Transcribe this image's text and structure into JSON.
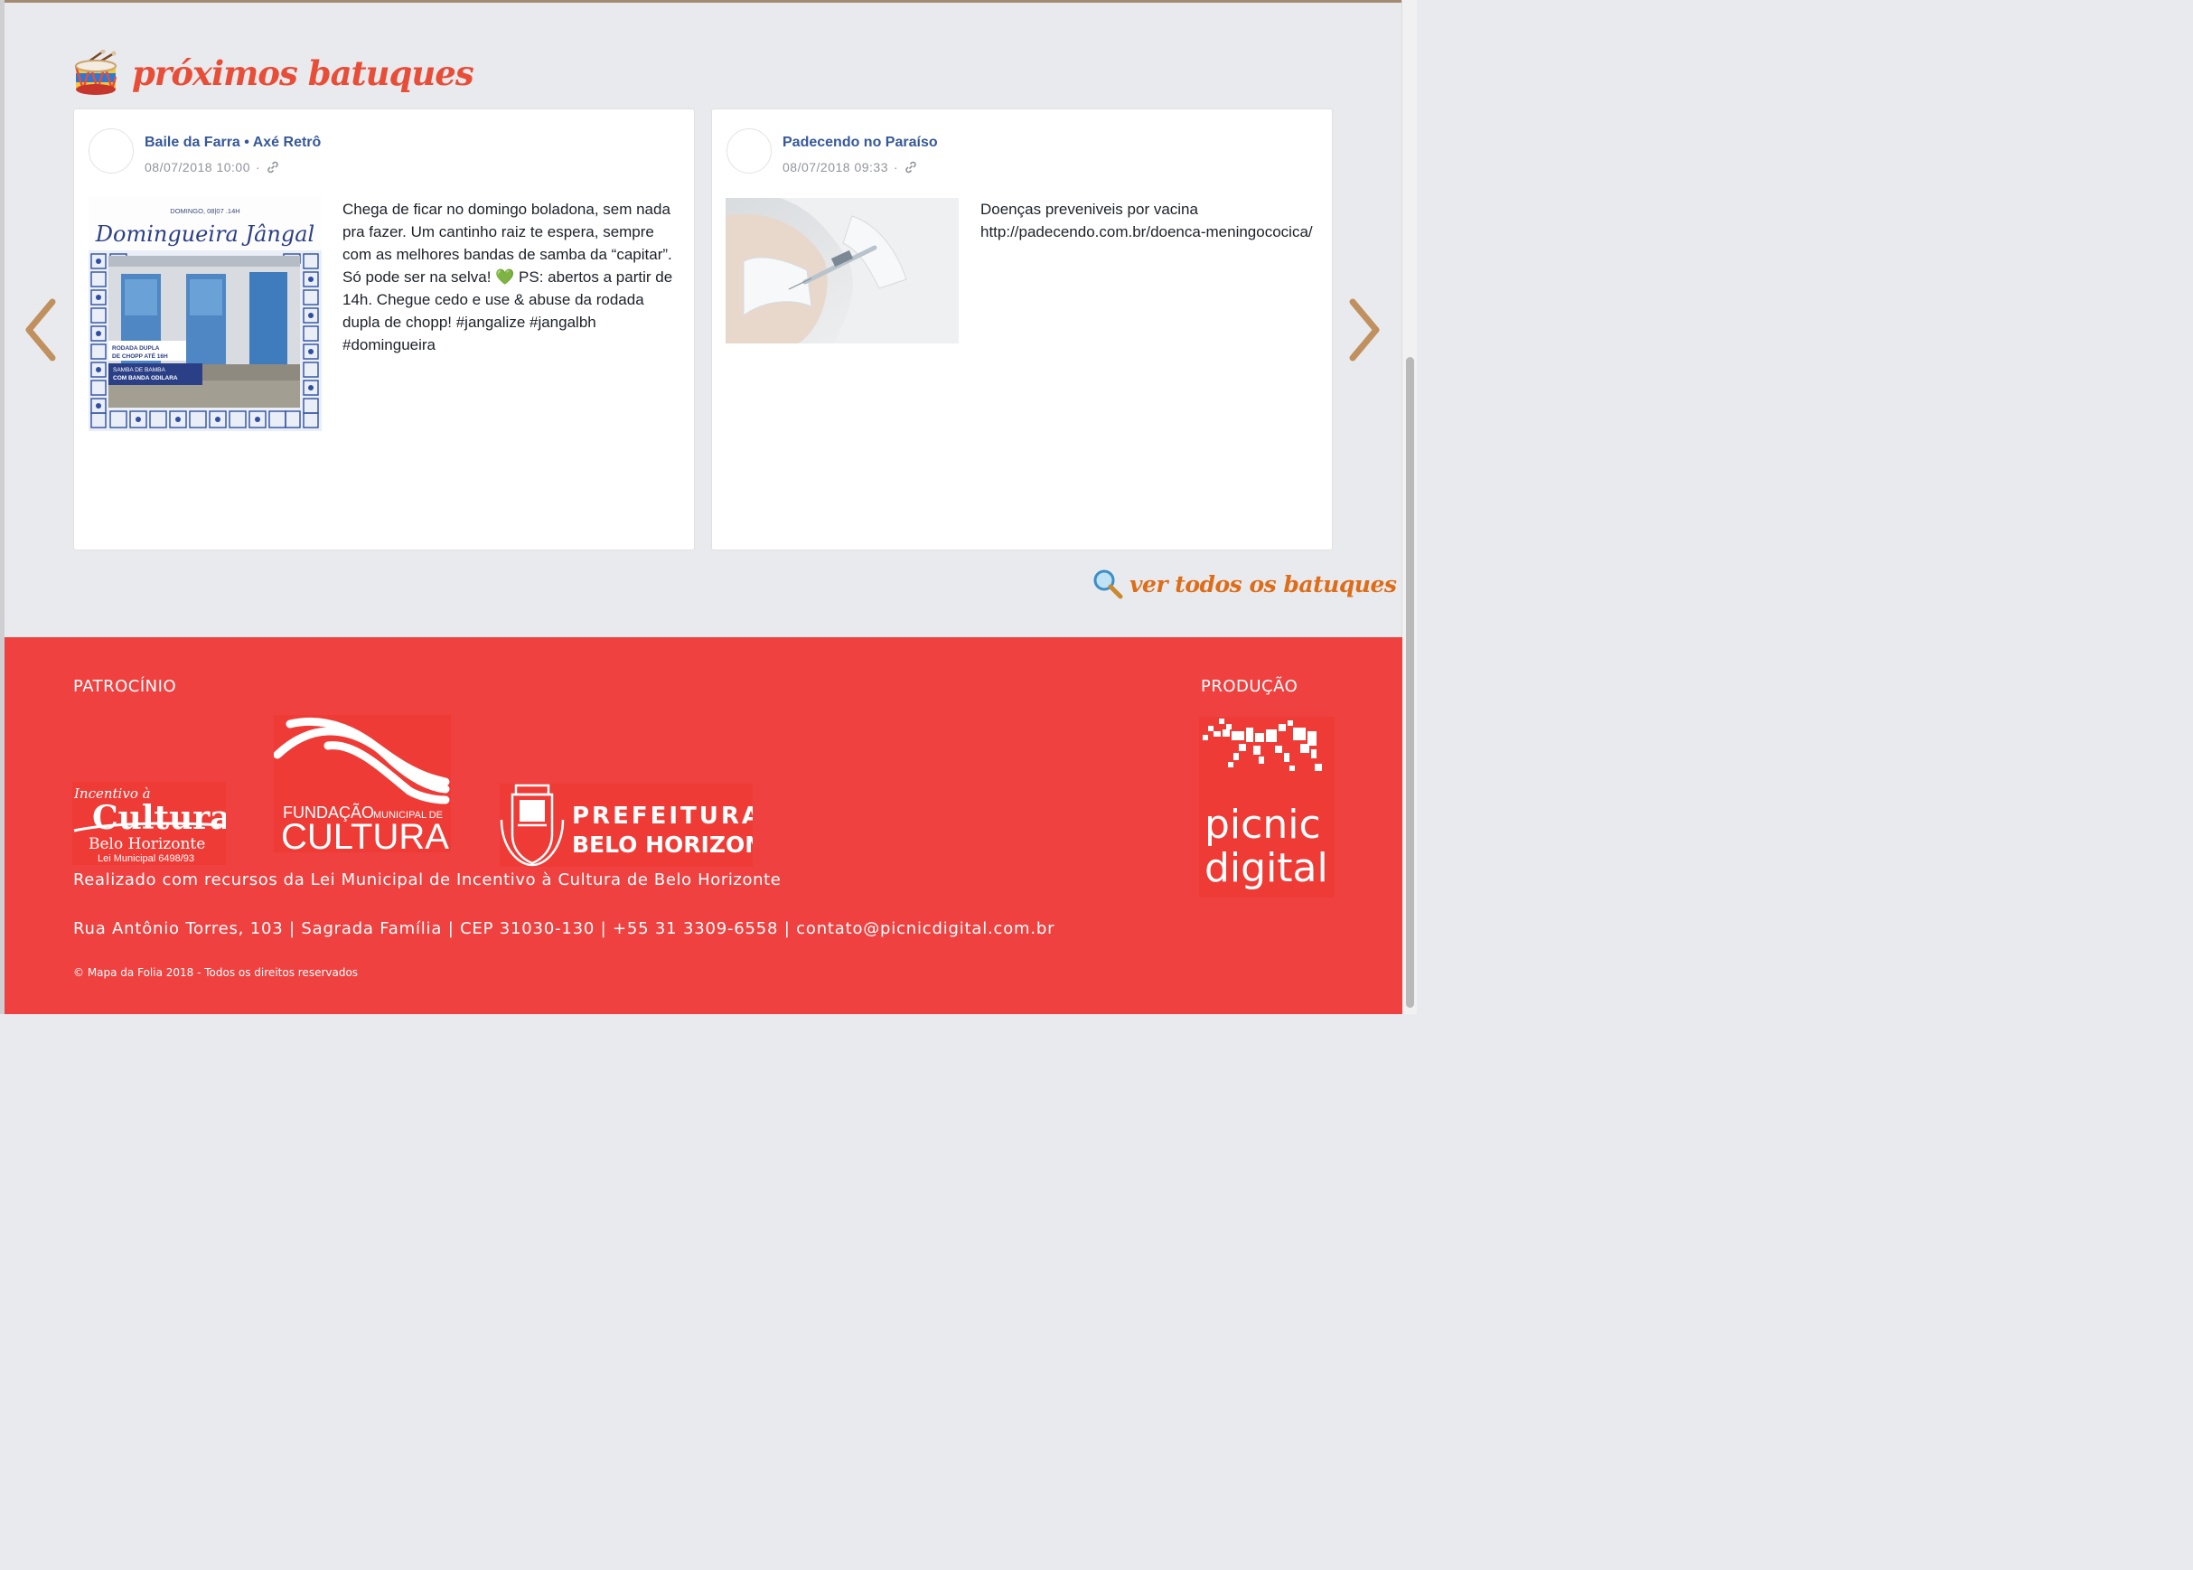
{
  "section": {
    "title": "próximos batuques",
    "see_all_label": "ver todos os batuques"
  },
  "posts": [
    {
      "name": "Baile da Farra • Axé Retrô",
      "date": "08/07/2018 10:00",
      "text": "Chega de ficar no domingo boladona, sem nada pra fazer. Um cantinho raiz te espera, sempre com as melhores bandas de samba da “capitar”. Só pode ser na selva! 💚 PS: abertos a partir de 14h. Chegue cedo e use & abuse da rodada dupla de chopp! #jangalize #jangalbh #domingueira",
      "image": {
        "top_line": "DOMINGO, 08|07 .14H",
        "title": "Domingueira Jângal",
        "promo1_line1": "RODADA DUPLA",
        "promo1_line2": "DE CHOPP ATÉ 16H",
        "promo2_line1": "SAMBA DE BAMBA",
        "promo2_line2": "COM BANDA ODILARA"
      }
    },
    {
      "name": "Padecendo no Paraíso",
      "date": "08/07/2018 09:33",
      "text": "Doenças preveniveis por vacina http://padecendo.com.br/doenca-meningococica/"
    }
  ],
  "footer": {
    "patrocinio": "PATROCÍNIO",
    "producao": "PRODUÇÃO",
    "realizado": "Realizado com recursos da Lei Municipal de Incentivo à Cultura de Belo Horizonte",
    "address": "Rua Antônio Torres, 103 | Sagrada Família | CEP 31030-130 | +55 31 3309-6558 | contato@picnicdigital.com.br",
    "copyright": "© Mapa da Folia 2018 - Todos os direitos reservados",
    "logos": {
      "incentivo_small": "Incentivo à",
      "incentivo_big": "Cultura",
      "incentivo_city": "Belo Horizonte",
      "incentivo_law": "Lei Municipal 6498/93",
      "fundacao_line1": "FUNDAÇÃO",
      "fundacao_line1b": "MUNICIPAL DE",
      "fundacao_line2": "CULTURA",
      "prefeitura_line1": "PREFEITURA",
      "prefeitura_line2": "BELO HORIZONTE",
      "picnic_line1": "picnic",
      "picnic_line2": "digital"
    }
  },
  "colors": {
    "footer_bg": "#ee4140",
    "title_red": "#e84d37",
    "see_all_orange": "#dd6d19",
    "arrow_brown": "#c0905f",
    "fb_blue": "#365899"
  }
}
